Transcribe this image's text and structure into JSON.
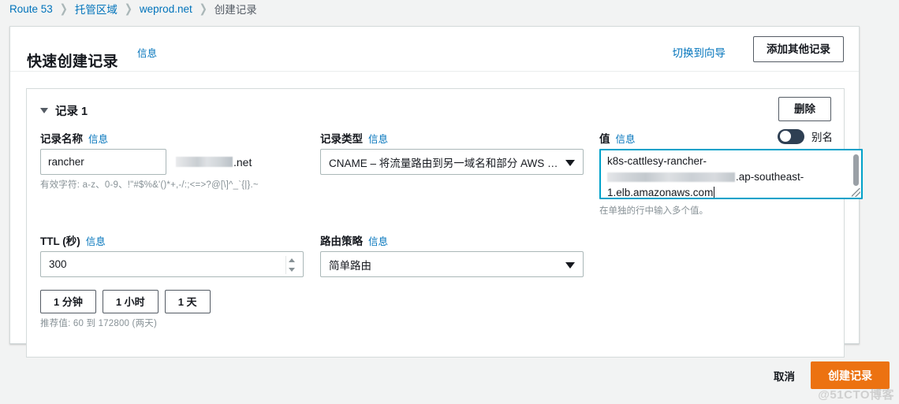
{
  "breadcrumb": {
    "items": [
      {
        "label": "Route 53",
        "type": "link"
      },
      {
        "label": "托管区域",
        "type": "link"
      },
      {
        "label": "weprod.net",
        "type": "link"
      },
      {
        "label": "创建记录",
        "type": "current"
      }
    ],
    "separator": "❯"
  },
  "header": {
    "title": "快速创建记录",
    "info_label": "信息",
    "switch_to_wizard": "切换到向导",
    "add_another_record": "添加其他记录"
  },
  "record": {
    "section_label": "记录 1",
    "delete_label": "删除",
    "name": {
      "label": "记录名称",
      "info_label": "信息",
      "value": "rancher",
      "domain_suffix": ".net",
      "hint": "有效字符: a-z、0-9、!\"#$%&'()*+,-/:;<=>?@[\\]^_`{|}.~"
    },
    "type": {
      "label": "记录类型",
      "info_label": "信息",
      "value": "CNAME – 将流量路由到另一域名和部分 AWS …"
    },
    "value": {
      "label": "值",
      "info_label": "信息",
      "alias_label": "别名",
      "alias_enabled": false,
      "line1": "k8s-cattlesy-rancher-",
      "line2_suffix": ".ap-southeast-",
      "line3": "1.elb.amazonaws.com",
      "hint": "在单独的行中输入多个值。"
    },
    "ttl": {
      "label": "TTL (秒)",
      "info_label": "信息",
      "value": "300",
      "presets": [
        "1 分钟",
        "1 小时",
        "1 天"
      ],
      "hint": "推荐值: 60 到 172800 (两天)"
    },
    "routing": {
      "label": "路由策略",
      "info_label": "信息",
      "value": "简单路由"
    }
  },
  "footer": {
    "cancel_label": "取消",
    "create_label": "创建记录"
  },
  "watermark": "@51CTO博客",
  "colors": {
    "link": "#0073bb",
    "primary_action": "#ec7211",
    "focus_border": "#00a1c9",
    "toggle_track": "#2e3f53"
  }
}
